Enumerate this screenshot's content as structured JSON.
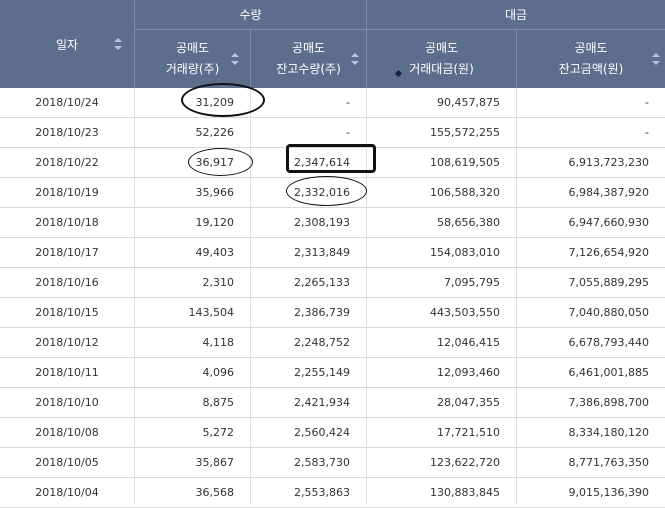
{
  "header": {
    "date_label": "일자",
    "group_quantity": "수량",
    "group_amount": "대금",
    "quantity_volume_line1": "공매도",
    "quantity_volume_line2": "거래량(주)",
    "quantity_balance_line1": "공매도",
    "quantity_balance_line2": "잔고수량(주)",
    "amount_trade_line1": "공매도",
    "amount_trade_line2": "거래대금(원)",
    "amount_balance_line1": "공매도",
    "amount_balance_line2": "잔고금액(원)"
  },
  "rows": [
    {
      "date": "2018/10/24",
      "volume": "31,209",
      "balance_qty": "-",
      "trade_amount": "90,457,875",
      "balance_amount": "-"
    },
    {
      "date": "2018/10/23",
      "volume": "52,226",
      "balance_qty": "-",
      "trade_amount": "155,572,255",
      "balance_amount": "-"
    },
    {
      "date": "2018/10/22",
      "volume": "36,917",
      "balance_qty": "2,347,614",
      "trade_amount": "108,619,505",
      "balance_amount": "6,913,723,230"
    },
    {
      "date": "2018/10/19",
      "volume": "35,966",
      "balance_qty": "2,332,016",
      "trade_amount": "106,588,320",
      "balance_amount": "6,984,387,920"
    },
    {
      "date": "2018/10/18",
      "volume": "19,120",
      "balance_qty": "2,308,193",
      "trade_amount": "58,656,380",
      "balance_amount": "6,947,660,930"
    },
    {
      "date": "2018/10/17",
      "volume": "49,403",
      "balance_qty": "2,313,849",
      "trade_amount": "154,083,010",
      "balance_amount": "7,126,654,920"
    },
    {
      "date": "2018/10/16",
      "volume": "2,310",
      "balance_qty": "2,265,133",
      "trade_amount": "7,095,795",
      "balance_amount": "7,055,889,295"
    },
    {
      "date": "2018/10/15",
      "volume": "143,504",
      "balance_qty": "2,386,739",
      "trade_amount": "443,503,550",
      "balance_amount": "7,040,880,050"
    },
    {
      "date": "2018/10/12",
      "volume": "4,118",
      "balance_qty": "2,248,752",
      "trade_amount": "12,046,415",
      "balance_amount": "6,678,793,440"
    },
    {
      "date": "2018/10/11",
      "volume": "4,096",
      "balance_qty": "2,255,149",
      "trade_amount": "12,093,460",
      "balance_amount": "6,461,001,885"
    },
    {
      "date": "2018/10/10",
      "volume": "8,875",
      "balance_qty": "2,421,934",
      "trade_amount": "28,047,355",
      "balance_amount": "7,386,898,700"
    },
    {
      "date": "2018/10/08",
      "volume": "5,272",
      "balance_qty": "2,560,424",
      "trade_amount": "17,721,510",
      "balance_amount": "8,334,180,120"
    },
    {
      "date": "2018/10/05",
      "volume": "35,867",
      "balance_qty": "2,583,730",
      "trade_amount": "123,622,720",
      "balance_amount": "8,771,763,350"
    },
    {
      "date": "2018/10/04",
      "volume": "36,568",
      "balance_qty": "2,553,863",
      "trade_amount": "130,883,845",
      "balance_amount": "9,015,136,390"
    }
  ]
}
